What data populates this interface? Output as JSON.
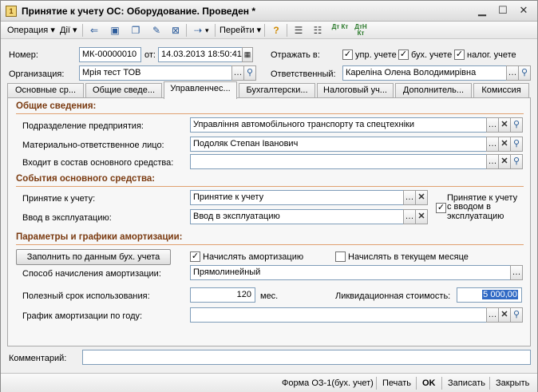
{
  "window": {
    "title": "Принятие к учету ОС: Оборудование. Проведен *"
  },
  "toolbar": {
    "operation": "Операция ▾",
    "actions": "Дії ▾",
    "goto": "Перейти ▾",
    "dt_kt": "Дт Кт",
    "dt_n_kt": "ДтН Кт"
  },
  "header": {
    "number_label": "Номер:",
    "number_value": "МК-00000010",
    "date_label": "от:",
    "date_value": "14.03.2013 18:50:41",
    "reflect_label": "Отражать в:",
    "chk_mgmt": "упр. учете",
    "chk_acc": "бух. учете",
    "chk_tax": "налог. учете",
    "org_label": "Организация:",
    "org_value": "Мрія тест ТОВ",
    "resp_label": "Ответственный:",
    "resp_value": "Кареліна Олена Володимирівна"
  },
  "tabs": [
    "Основные ср...",
    "Общие сведе...",
    "Управленчес...",
    "Бухгалтерски...",
    "Налоговый уч...",
    "Дополнитель...",
    "Комиссия"
  ],
  "general": {
    "section": "Общие сведения:",
    "dept_label": "Подразделение предприятия:",
    "dept_value": "Управління автомобільного транспорту та спецтехніки",
    "mol_label": "Материально-ответственное лицо:",
    "mol_value": "Подоляк Степан Іванович",
    "part_label": "Входит в состав основного средства:",
    "part_value": ""
  },
  "events": {
    "section": "События основного средства:",
    "accept_label": "Принятие к учету:",
    "accept_value": "Принятие к учету",
    "commission_label": "Ввод в эксплуатацию:",
    "commission_value": "Ввод в эксплуатацию",
    "side_text": "Принятие к учету",
    "side_chk": "с вводом в эксплуатацию"
  },
  "depreciation": {
    "section": "Параметры и графики амортизации:",
    "fill_button": "Заполнить по данным бух. учета",
    "chk_accrue": "Начислять амортизацию",
    "chk_current": "Начислять в текущем месяце",
    "method_label": "Способ начисления амортизации:",
    "method_value": "Прямолинейный",
    "life_label": "Полезный срок использования:",
    "life_value": "120",
    "life_unit": "мес.",
    "liquid_label": "Ликвидационная стоимость:",
    "liquid_value": "5 000,00",
    "schedule_label": "График амортизации по году:",
    "schedule_value": ""
  },
  "comment": {
    "label": "Комментарий:",
    "value": ""
  },
  "status": {
    "form": "Форма ОЗ-1(бух. учет)",
    "print": "Печать",
    "ok": "OK",
    "save": "Записать",
    "close": "Закрыть"
  }
}
